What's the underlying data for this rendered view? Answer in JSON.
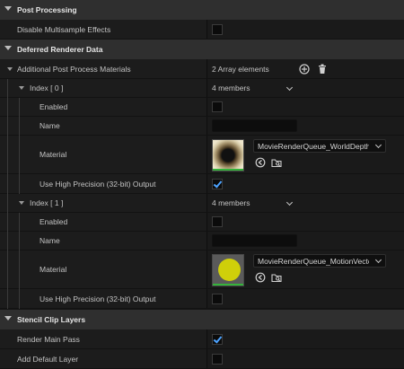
{
  "sections": {
    "post_processing": "Post Processing",
    "deferred": "Deferred Renderer Data",
    "stencil": "Stencil Clip Layers"
  },
  "props": {
    "disable_msaa": "Disable Multisample Effects",
    "additional_ppm": "Additional Post Process Materials",
    "array_count": "2 Array elements",
    "render_main_pass": "Render Main Pass",
    "add_default_layer": "Add Default Layer"
  },
  "elements": [
    {
      "index_label": "Index [ 0 ]",
      "members": "4 members",
      "enabled_label": "Enabled",
      "name_label": "Name",
      "material_label": "Material",
      "material_value": "MovieRenderQueue_WorldDepth",
      "precision_label": "Use High Precision (32-bit) Output",
      "enabled": false,
      "high_precision": true
    },
    {
      "index_label": "Index [ 1 ]",
      "members": "4 members",
      "enabled_label": "Enabled",
      "name_label": "Name",
      "material_label": "Material",
      "material_value": "MovieRenderQueue_MotionVectors",
      "precision_label": "Use High Precision (32-bit) Output",
      "enabled": false,
      "high_precision": false
    }
  ],
  "values": {
    "disable_msaa": false,
    "render_main_pass": true,
    "add_default_layer": false
  },
  "colors": {
    "checkmark": "#4da3ff",
    "motion_vector_dot": "#cfcf0a",
    "thumbnail_underline": "#35b43b"
  }
}
